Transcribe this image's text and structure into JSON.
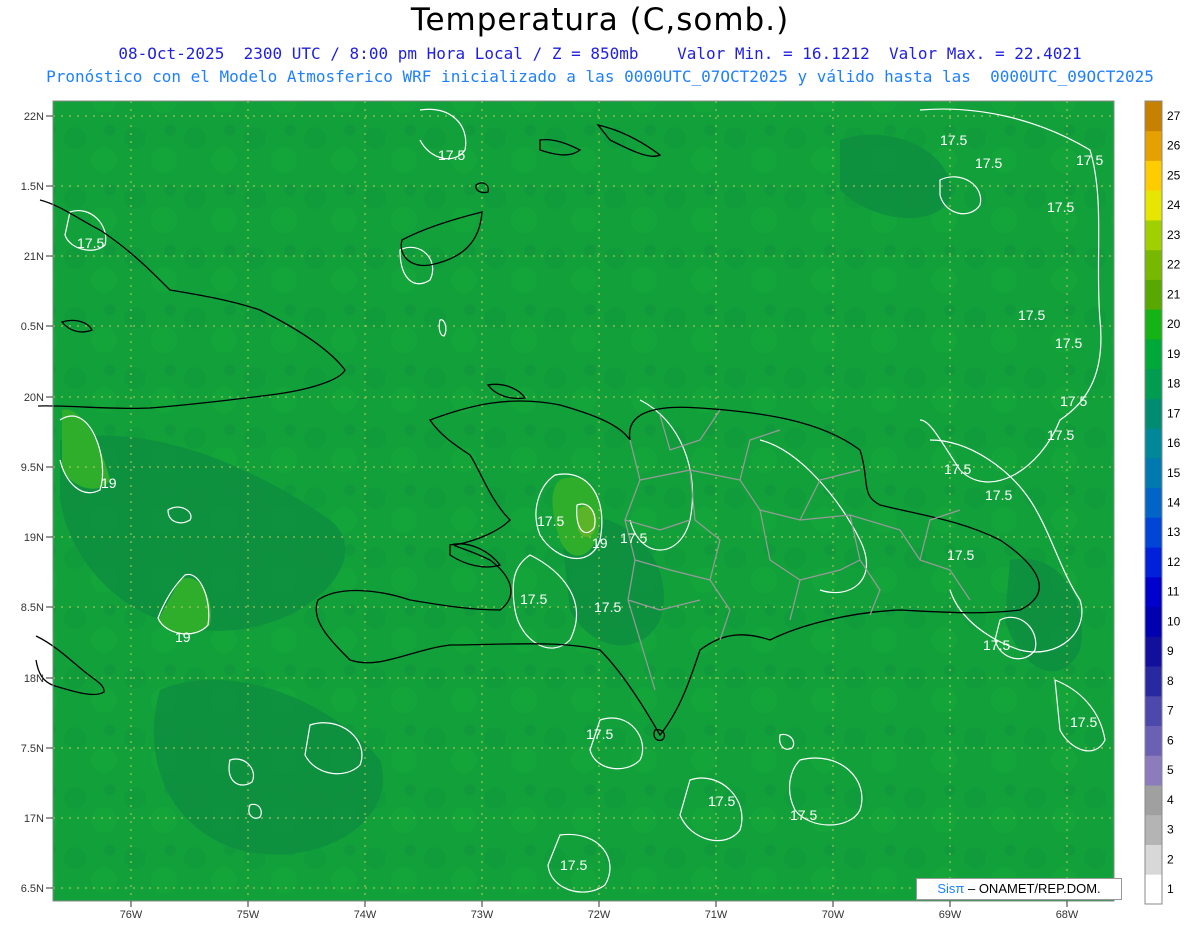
{
  "header": {
    "title": "Temperatura (C,somb.)",
    "line1": "08-Oct-2025  2300 UTC / 8:00 pm Hora Local / Z = 850mb    Valor Min. = 16.1212  Valor Max. = 22.4021",
    "line2": "Pronóstico con el Modelo Atmosferico WRF inicializado a las 0000UTC_07OCT2025 y válido hasta las  0000UTC_09OCT2025"
  },
  "axes": {
    "lat_labels": [
      "22N",
      "1.5N",
      "21N",
      "0.5N",
      "20N",
      "9.5N",
      "19N",
      "8.5N",
      "18N",
      "7.5N",
      "17N",
      "6.5N"
    ],
    "lon_labels": [
      "76W",
      "75W",
      "74W",
      "73W",
      "72W",
      "71W",
      "70W",
      "69W",
      "68W"
    ]
  },
  "colorbar": {
    "levels": [
      "1",
      "2",
      "3",
      "4",
      "5",
      "6",
      "7",
      "8",
      "9",
      "10",
      "11",
      "12",
      "13",
      "14",
      "15",
      "16",
      "17",
      "18",
      "19",
      "20",
      "21",
      "22",
      "23",
      "24",
      "25",
      "26",
      "27"
    ],
    "colors": [
      "#ffffff",
      "#d8d8d8",
      "#b4b4b4",
      "#a0a0a0",
      "#8c7cbc",
      "#6c60b4",
      "#4c48ac",
      "#2828a0",
      "#10109c",
      "#0000b0",
      "#0000cc",
      "#0020dc",
      "#0044d8",
      "#0064c8",
      "#0078b0",
      "#008898",
      "#008c70",
      "#009c50",
      "#00a838",
      "#14b414",
      "#58a800",
      "#78b800",
      "#a0d000",
      "#e6e600",
      "#ffcc00",
      "#e6a000",
      "#c88000"
    ]
  },
  "contour_labels": [
    {
      "text": "17.5"
    },
    {
      "text": "17.5"
    },
    {
      "text": "17.5"
    },
    {
      "text": "17.5"
    },
    {
      "text": "17.5"
    },
    {
      "text": "17.5"
    },
    {
      "text": "17.5"
    },
    {
      "text": "17.5"
    },
    {
      "text": "17.5"
    },
    {
      "text": "17.5"
    },
    {
      "text": "17.5"
    },
    {
      "text": "17.5"
    },
    {
      "text": "17.5"
    },
    {
      "text": "17.5"
    },
    {
      "text": "17.5"
    },
    {
      "text": "17.5"
    },
    {
      "text": "17.5"
    },
    {
      "text": "17.5"
    },
    {
      "text": "19"
    },
    {
      "text": "19"
    },
    {
      "text": "19"
    },
    {
      "text": "17.5"
    },
    {
      "text": "17.5"
    },
    {
      "text": "17.5"
    }
  ],
  "credit": {
    "sis": "Sisπ",
    "rest": " – ONAMET/REP.DOM."
  },
  "colors": {
    "field": "#12a03a",
    "field_dark": "#0e8f40",
    "field_warm": "#4fb22c",
    "contour": "#ffffff",
    "coast": "#000000",
    "border": "#9a9a9a",
    "grid": "#c8c860"
  }
}
